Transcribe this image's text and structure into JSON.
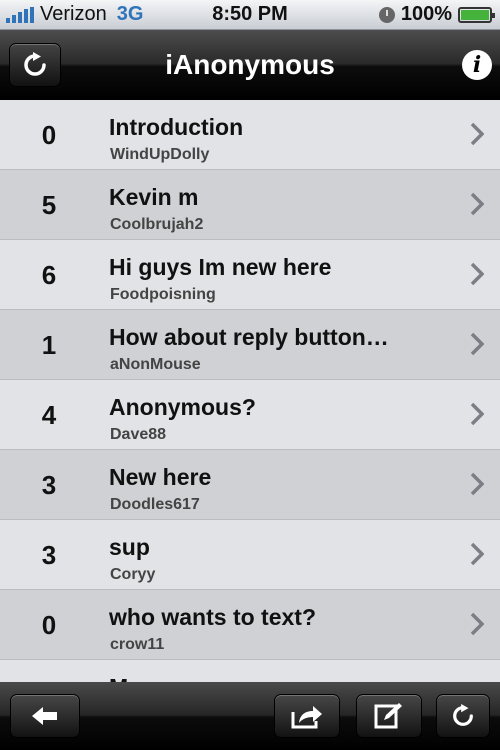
{
  "status_bar": {
    "carrier": "Verizon",
    "network": "3G",
    "time": "8:50 PM",
    "battery": "100%"
  },
  "nav_bar": {
    "title": "iAnonymous",
    "left_icon": "refresh-icon",
    "right_icon": "info-icon"
  },
  "threads": [
    {
      "count": "0",
      "title": "Introduction",
      "author": "WindUpDolly"
    },
    {
      "count": "5",
      "title": "Kevin m",
      "author": "Coolbrujah2"
    },
    {
      "count": "6",
      "title": "Hi guys Im new here",
      "author": "Foodpoisning"
    },
    {
      "count": "1",
      "title": "How about reply button…",
      "author": "aNonMouse"
    },
    {
      "count": "4",
      "title": "Anonymous?",
      "author": "Dave88"
    },
    {
      "count": "3",
      "title": "New here",
      "author": "Doodles617"
    },
    {
      "count": "3",
      "title": "sup",
      "author": "Coryy"
    },
    {
      "count": "0",
      "title": "who wants to text?",
      "author": "crow11"
    },
    {
      "count": "",
      "title": "M",
      "author": ""
    }
  ],
  "tool_bar": {
    "icons": [
      "back-arrow-icon",
      "share-icon",
      "compose-icon",
      "refresh-icon"
    ]
  },
  "colors": {
    "accent_blue": "#2f73b8",
    "row_light": "#e2e3e6",
    "row_dark": "#cfd1d5",
    "battery_green": "#45b23c"
  }
}
